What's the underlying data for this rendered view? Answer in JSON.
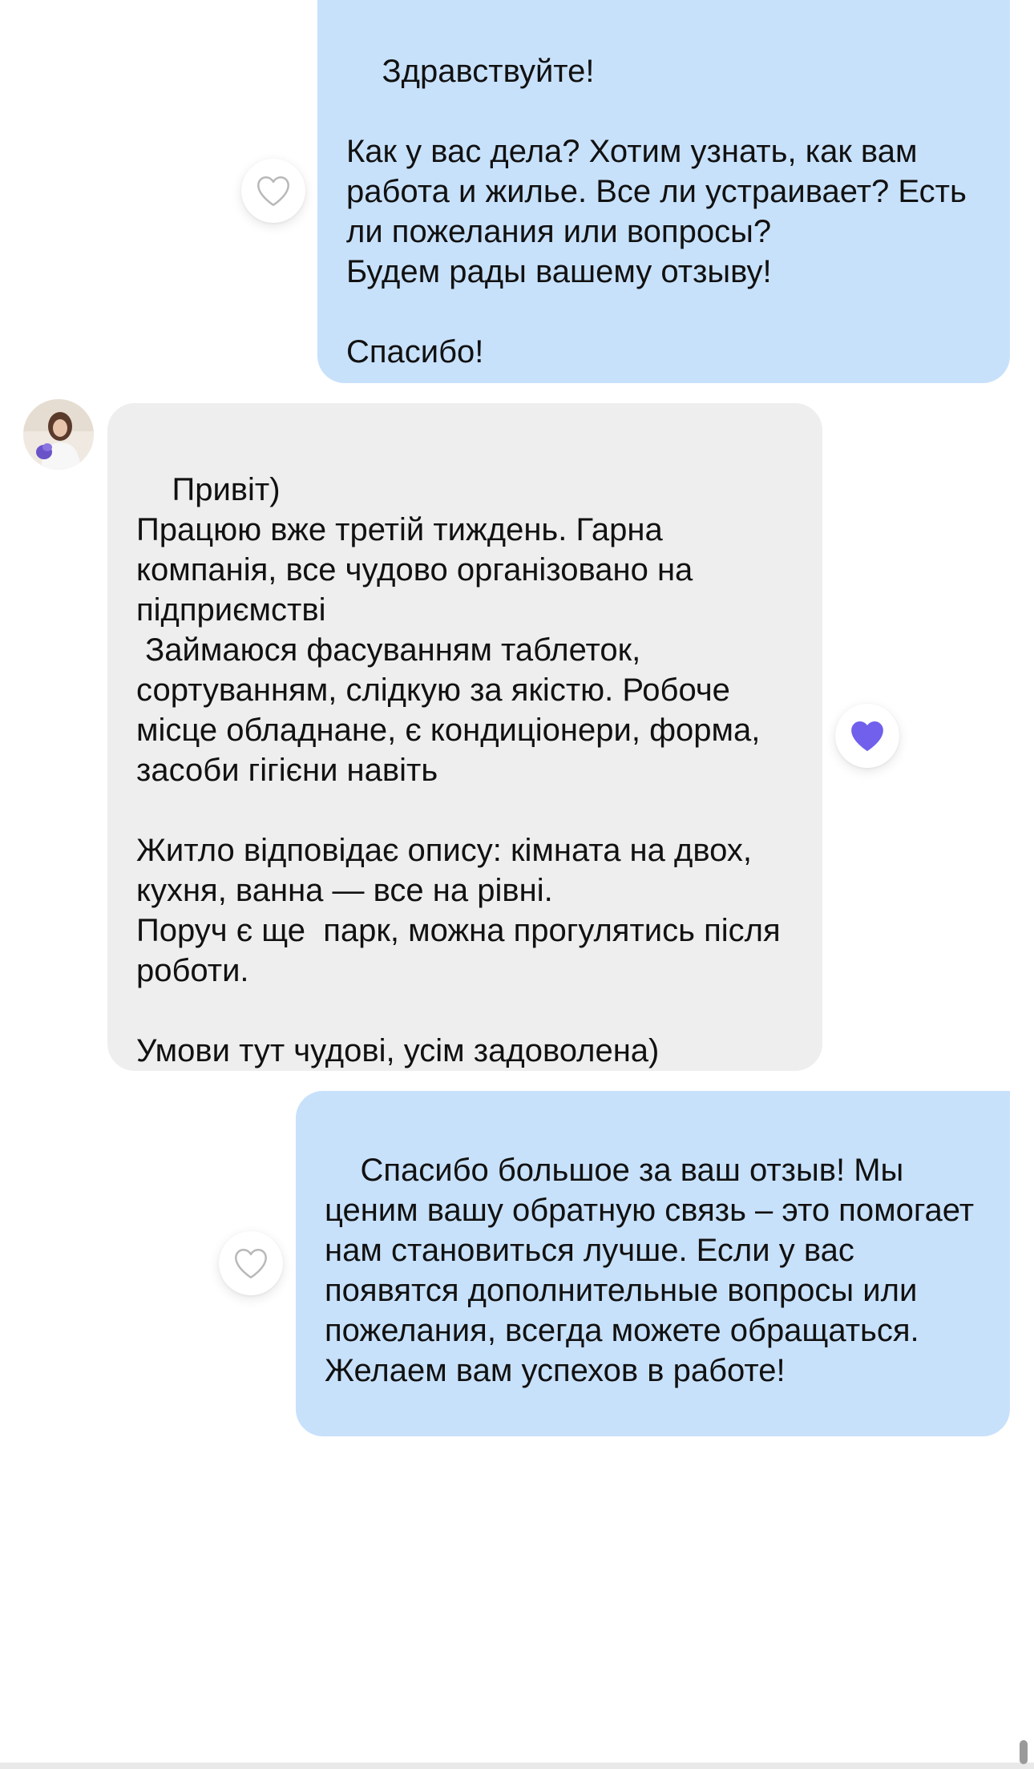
{
  "messages": [
    {
      "direction": "outgoing",
      "text": "Здравствуйте!\n\nКак у вас дела? Хотим узнать, как вам работа и жилье. Все ли устраивает? Есть ли пожелания или вопросы?\nБудем рады вашему отзыву!\n\nСпасибо!",
      "liked": false,
      "icon": "heart-outline-icon"
    },
    {
      "direction": "incoming",
      "text": "Привіт)\nПрацюю вже третій тиждень. Гарна компанія, все чудово організовано на підприємстві\n Займаюся фасуванням таблеток, сортуванням, слідкую за якістю. Робоче місце обладнане, є кондиціонери, форма, засоби гігієни навіть\n\nЖитло відповідає опису: кімната на двох, кухня, ванна — все на рівні.\nПоруч є ще  парк, можна прогулятись після роботи.\n\nУмови тут чудові, усім задоволена)",
      "liked": true,
      "icon": "heart-filled-icon",
      "avatar": "user-avatar"
    },
    {
      "direction": "outgoing",
      "text": "Спасибо большое за ваш отзыв! Мы ценим вашу обратную связь – это помогает нам становиться лучше. Если у вас появятся дополнительные вопросы или пожелания, всегда можете обращаться. Желаем вам успехов в работе!",
      "liked": false,
      "icon": "heart-outline-icon"
    }
  ],
  "colors": {
    "outgoing_bubble": "#c8e1fb",
    "incoming_bubble": "#eeeeee",
    "heart_filled": "#7060ec",
    "heart_outline": "#b8b8b8",
    "background": "#ffffff"
  }
}
